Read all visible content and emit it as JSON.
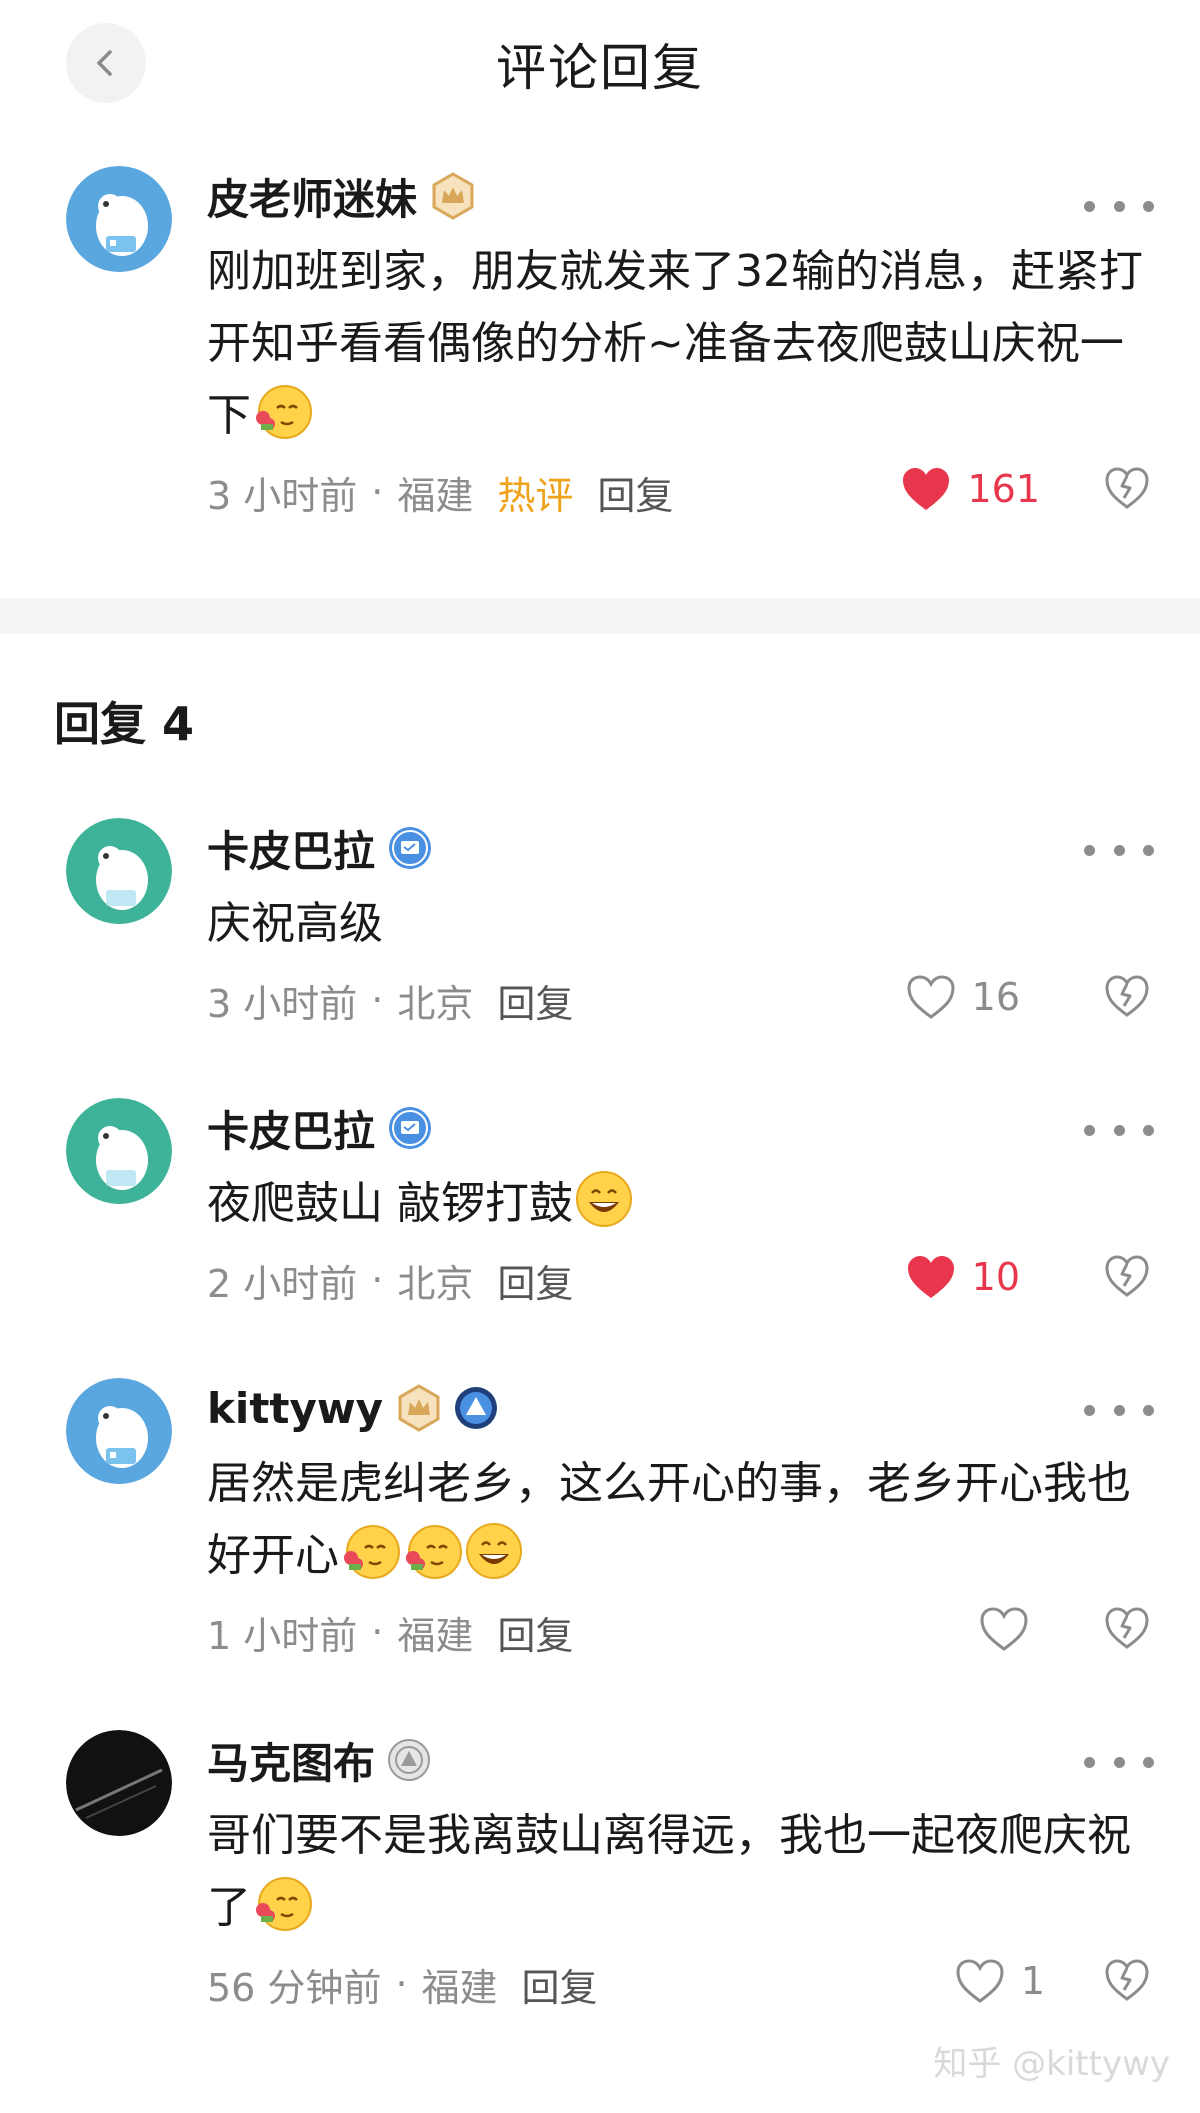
{
  "header": {
    "title": "评论回复",
    "back_icon": "chevron-left-icon"
  },
  "main_comment": {
    "username": "皮老师迷妹",
    "badge": "crown-badge-icon",
    "text": "刚加班到家，朋友就发来了32输的消息，赶紧打开知乎看看偶像的分析~准备去夜爬鼓山庆祝一下",
    "emojis": [
      "flower-smile-emoji"
    ],
    "time": "3 小时前",
    "location": "福建",
    "hot_tag": "热评",
    "reply_label": "回复",
    "likes": "161",
    "liked": true
  },
  "replies_header": "回复 4",
  "replies": [
    {
      "username": "卡皮巴拉",
      "badges": [
        "verified-message-badge-icon"
      ],
      "text": "庆祝高级",
      "emojis": [],
      "time": "3 小时前",
      "location": "北京",
      "reply_label": "回复",
      "likes": "16",
      "liked": false
    },
    {
      "username": "卡皮巴拉",
      "badges": [
        "verified-message-badge-icon"
      ],
      "text": "夜爬鼓山 敲锣打鼓",
      "emojis": [
        "grin-emoji"
      ],
      "time": "2 小时前",
      "location": "北京",
      "reply_label": "回复",
      "likes": "10",
      "liked": true
    },
    {
      "username": "kittywy",
      "badges": [
        "crown-badge-icon",
        "triangle-badge-icon"
      ],
      "text": "居然是虎纠老乡，这么开心的事，老乡开心我也好开心",
      "emojis": [
        "flower-smile-emoji",
        "flower-smile-emoji",
        "grin-emoji"
      ],
      "time": "1 小时前",
      "location": "福建",
      "reply_label": "回复",
      "likes": "",
      "liked": false
    },
    {
      "username": "马克图布",
      "badges": [
        "grey-seal-badge-icon"
      ],
      "text": "哥们要不是我离鼓山离得远，我也一起夜爬庆祝了",
      "emojis": [
        "flower-smile-emoji"
      ],
      "time": "56 分钟前",
      "location": "福建",
      "reply_label": "回复",
      "likes": "1",
      "liked": false
    }
  ],
  "watermark": "知乎 @kittywy",
  "colors": {
    "like_red": "#e8364c",
    "hot_orange": "#f0a21a",
    "meta_grey": "#8c8c8c"
  }
}
